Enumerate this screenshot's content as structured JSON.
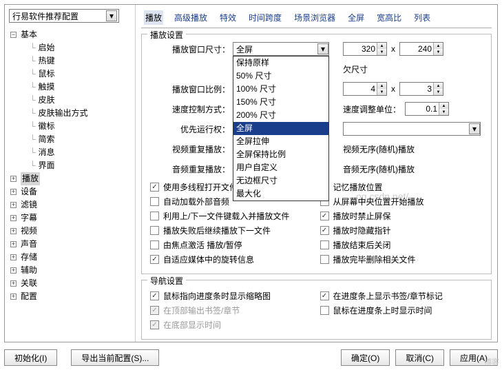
{
  "profile": "行易软件推荐配置",
  "tree": {
    "root": "基本",
    "children": [
      "启始",
      "热键",
      "鼠标",
      "触摸",
      "皮肤",
      "皮肤输出方式",
      "徽标",
      "简索",
      "消息",
      "界面"
    ],
    "siblings": [
      "播放",
      "设备",
      "滤镜",
      "字幕",
      "视频",
      "声音",
      "存储",
      "辅助",
      "关联",
      "配置"
    ]
  },
  "tabs": [
    "播放",
    "高级播放",
    "特效",
    "时间跨度",
    "场景浏览器",
    "全屏",
    "宽高比",
    "列表"
  ],
  "active_tab": "播放",
  "play_settings": {
    "legend": "播放设置",
    "window_size_label": "播放窗口尺寸：",
    "window_size_value": "全屏",
    "size_options": [
      "保持原样",
      "50% 尺寸",
      "100% 尺寸",
      "150% 尺寸",
      "200% 尺寸",
      "全屏",
      "全屏拉伸",
      "全屏保持比例",
      "用户自定义",
      "无边框尺寸",
      "最大化"
    ],
    "selected_option": "全屏",
    "remember_size": "欠尺寸",
    "width": "320",
    "height": "240",
    "ratio_label": "播放窗口比例：",
    "ratio_a": "4",
    "ratio_b": "3",
    "speed_label": "速度控制方式：",
    "speed_unit_label": "速度调整单位：",
    "speed_unit": "0.1",
    "priority_label": "优先运行权：",
    "vrepeat_label": "视频重复播放：",
    "vrepeat_text": "视频无序(随机)播放",
    "arepeat_label": "音频重复播放：",
    "arepeat_text": "音频无序(随机)播放",
    "checks_left": [
      {
        "label": "使用多线程打开文件",
        "checked": true
      },
      {
        "label": "自动加载外部音频",
        "checked": false
      },
      {
        "label": "利用上/下一文件键载入并播放文件",
        "checked": false
      },
      {
        "label": "播放失败后继续播放下一文件",
        "checked": false
      },
      {
        "label": "由焦点激活 播放/暂停",
        "checked": false
      },
      {
        "label": "自适应媒体中的旋转信息",
        "checked": true
      }
    ],
    "checks_right": [
      {
        "label": "记忆播放位置",
        "checked": false
      },
      {
        "label": "从屏幕中央位置开始播放",
        "checked": false
      },
      {
        "label": "播放时禁止屏保",
        "checked": true
      },
      {
        "label": "播放时隐藏指针",
        "checked": true
      },
      {
        "label": "播放结束后关闭",
        "checked": false
      },
      {
        "label": "播放完毕删除相关文件",
        "checked": false
      }
    ]
  },
  "nav_settings": {
    "legend": "导航设置",
    "left": [
      {
        "label": "鼠标指向进度条时显示缩略图",
        "checked": true,
        "disabled": false
      },
      {
        "label": "在顶部输出书签/章节",
        "checked": true,
        "disabled": true
      },
      {
        "label": "在底部显示时间",
        "checked": true,
        "disabled": true
      }
    ],
    "right": [
      {
        "label": "在进度条上显示书签/章节标记",
        "checked": true
      },
      {
        "label": "鼠标在进度条上时显示时间",
        "checked": false
      }
    ]
  },
  "buttons": {
    "init": "初始化(I)",
    "export": "导出当前配置(S)...",
    "ok": "确定(O)",
    "cancel": "取消(C)",
    "apply": "应用(A)"
  },
  "watermark": "og.csdn.net/"
}
